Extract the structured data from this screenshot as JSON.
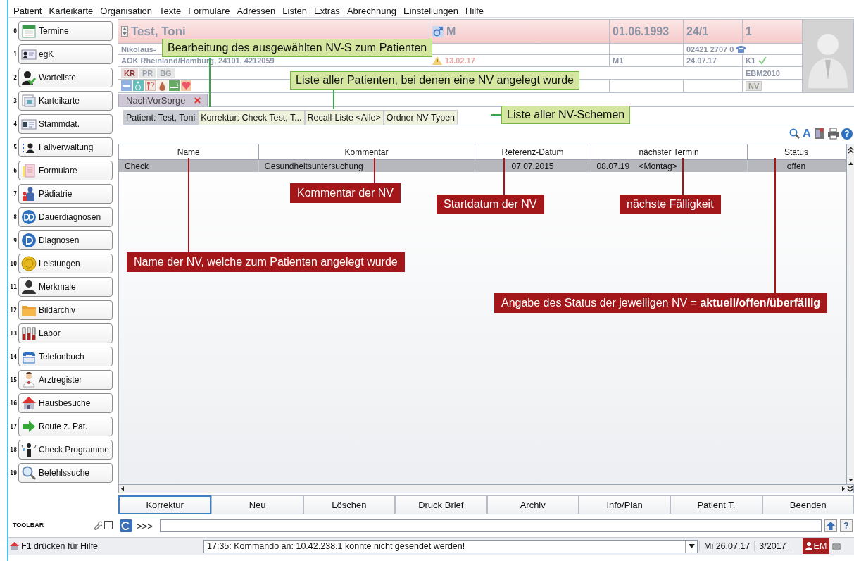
{
  "menu": [
    "Patient",
    "Karteikarte",
    "Organisation",
    "Texte",
    "Formulare",
    "Adressen",
    "Listen",
    "Extras",
    "Abrechnung",
    "Einstellungen",
    "Hilfe"
  ],
  "sidebar": {
    "items": [
      {
        "number": "0",
        "label": "Termine"
      },
      {
        "number": "1",
        "label": "egK"
      },
      {
        "number": "2",
        "label": "Warteliste"
      },
      {
        "number": "3",
        "label": "Karteikarte"
      },
      {
        "number": "4",
        "label": "Stammdat."
      },
      {
        "number": "5",
        "label": "Fallverwaltung"
      },
      {
        "number": "6",
        "label": "Formulare"
      },
      {
        "number": "7",
        "label": "Pädiatrie"
      },
      {
        "number": "8",
        "label": "Dauerdiagnosen"
      },
      {
        "number": "9",
        "label": "Diagnosen"
      },
      {
        "number": "10",
        "label": "Leistungen"
      },
      {
        "number": "11",
        "label": "Merkmale"
      },
      {
        "number": "12",
        "label": "Bildarchiv"
      },
      {
        "number": "13",
        "label": "Labor"
      },
      {
        "number": "14",
        "label": "Telefonbuch"
      },
      {
        "number": "15",
        "label": "Arztregister"
      },
      {
        "number": "16",
        "label": "Hausbesuche"
      },
      {
        "number": "17",
        "label": "Route z. Pat."
      },
      {
        "number": "18",
        "label": "Check Programme"
      },
      {
        "number": "19",
        "label": "Befehlssuche"
      }
    ],
    "toolbar_label": "TOOLBAR"
  },
  "patient": {
    "name": "Test, Toni",
    "gender": "M",
    "birthdate": "01.06.1993",
    "age": "24/1",
    "count": "1",
    "street": "Nikolaus-",
    "insurance": "AOK Rheinland/Hamburg, 24101, 4212059",
    "phone": "02421 2707 0",
    "warning_date": "13.02.17",
    "quarter_code": "M1",
    "last_visit": "24.07.17",
    "k_code": "K1",
    "fee_schedule": "EBM2010",
    "nv_badge": "NV",
    "tags": [
      {
        "label": "KR",
        "selected": true
      },
      {
        "label": "PR",
        "selected": false
      },
      {
        "label": "BG",
        "selected": false
      }
    ]
  },
  "module_tab": {
    "label": "NachVorSorge"
  },
  "tabs": [
    {
      "label": "Patient: Test, Toni",
      "selected": true
    },
    {
      "label": "Korrektur: Check  Test, T...",
      "selected": false
    },
    {
      "label": "Recall-Liste <Alle>",
      "selected": false
    },
    {
      "label": "Ordner NV-Typen",
      "selected": false
    }
  ],
  "toolbar": {
    "font_button": "A",
    "help_button": "?"
  },
  "table": {
    "columns": [
      "Name",
      "Kommentar",
      "Referenz-Datum",
      "nächster Termin",
      "Status"
    ],
    "rows": [
      {
        "cells": [
          "Check",
          "Gesundheitsuntersuchung",
          "07.07.2015",
          "08.07.19    <Montag>",
          "offen"
        ],
        "selected": true
      }
    ]
  },
  "buttons": [
    {
      "label": "Korrektur",
      "selected": true
    },
    {
      "label": "Neu",
      "selected": false
    },
    {
      "label": "Löschen",
      "selected": false
    },
    {
      "label": "Druck Brief",
      "selected": false
    },
    {
      "label": "Archiv",
      "selected": false
    },
    {
      "label": "Info/Plan",
      "selected": false
    },
    {
      "label": "Patient T.",
      "selected": false
    },
    {
      "label": "Beenden",
      "selected": false
    }
  ],
  "command_line": {
    "prompt": ">>>",
    "help_button": "?"
  },
  "status_bar": {
    "help": "F1 drücken für Hilfe",
    "message": "17:35: Kommando an: 10.42.238.1 konnte nicht gesendet werden!",
    "date": "Mi 26.07.17",
    "period": "3/2017",
    "user": "EM"
  },
  "annotations": [
    {
      "kind": "tip",
      "text": "Bearbeitung des ausgewählten NV-S zum Patienten"
    },
    {
      "kind": "tip",
      "text": "Liste aller Patienten, bei denen eine NV angelegt wurde"
    },
    {
      "kind": "tip",
      "text": "Liste aller NV-Schemen"
    },
    {
      "kind": "marker",
      "text": "Kommentar der NV"
    },
    {
      "kind": "marker",
      "text": "Startdatum der NV"
    },
    {
      "kind": "marker",
      "text": "nächste Fälligkeit"
    },
    {
      "kind": "marker",
      "text": "Name der NV, welche zum Patienten angelegt wurde"
    },
    {
      "kind": "marker",
      "text": "Angabe des Status der jeweiligen NV = **aktuell/offen/überfällig**"
    }
  ]
}
